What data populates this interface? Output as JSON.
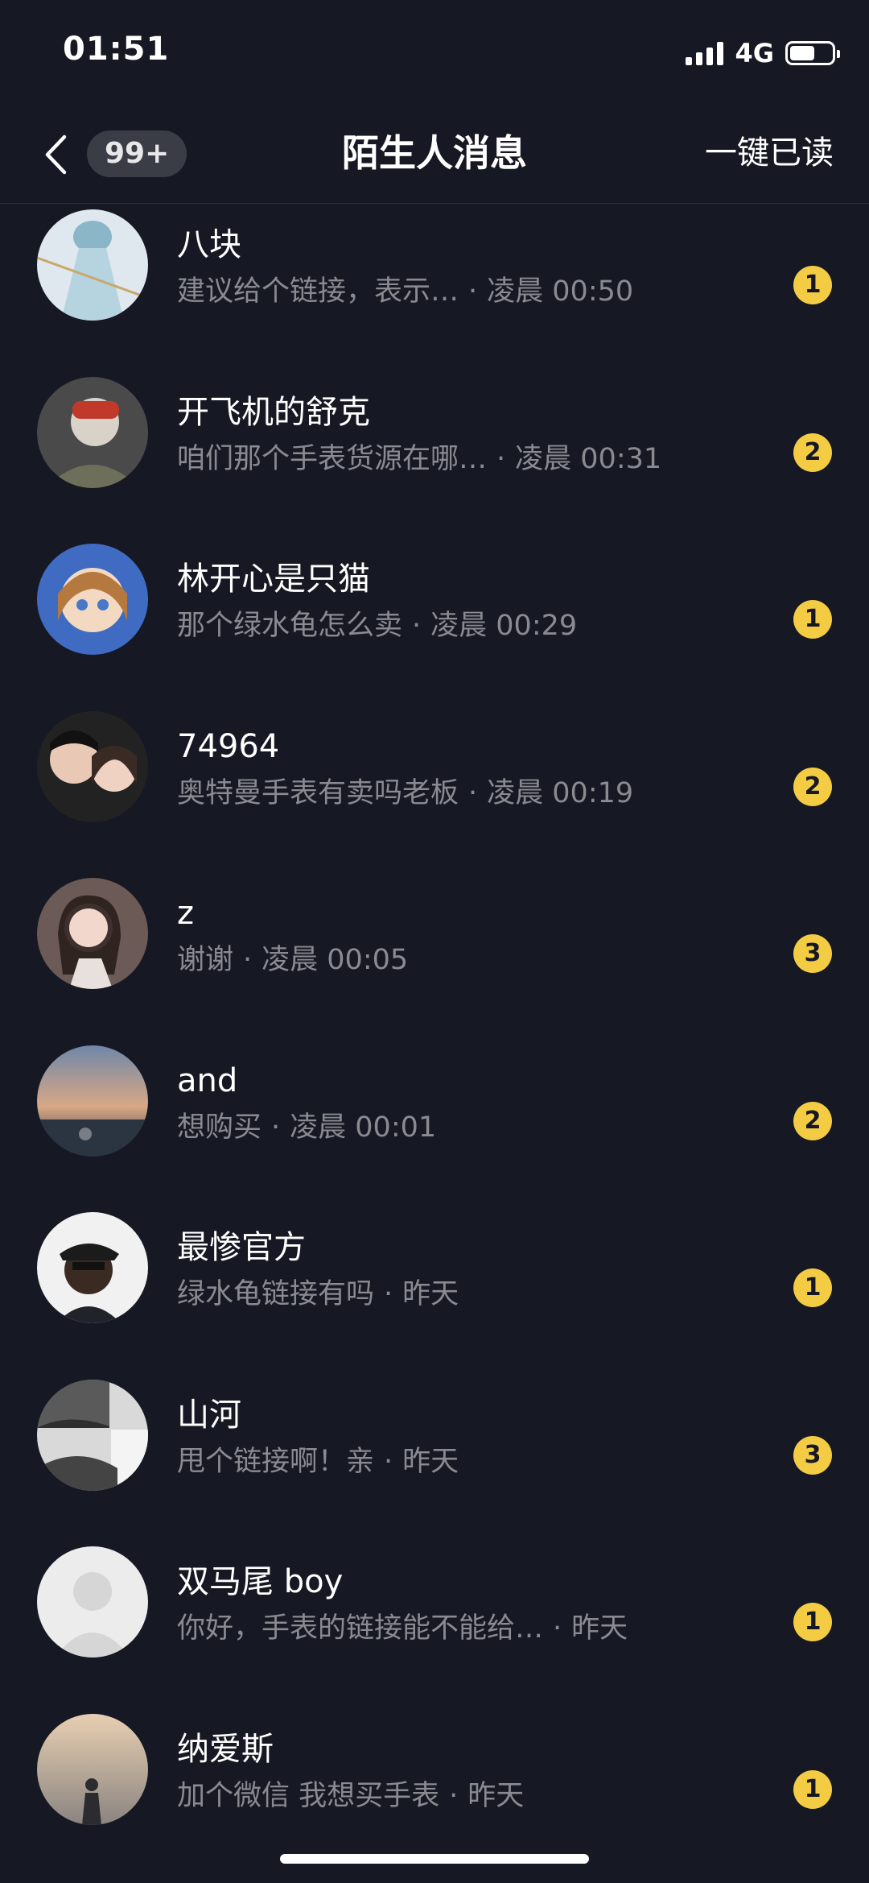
{
  "status_bar": {
    "time": "01:51",
    "network": "4G",
    "battery_level": 0.6
  },
  "header": {
    "back_icon": "chevron-left-icon",
    "unread_count": "99+",
    "title": "陌生人消息",
    "read_all_label": "一键已读"
  },
  "messages": [
    {
      "name": "八块",
      "preview": "建议给个链接，表示…",
      "time": "凌晨 00:50",
      "count": "1"
    },
    {
      "name": "开飞机的舒克",
      "preview": "咱们那个手表货源在哪…",
      "time": "凌晨 00:31",
      "count": "2"
    },
    {
      "name": "林开心是只猫",
      "preview": "那个绿水龟怎么卖",
      "time": "凌晨 00:29",
      "count": "1"
    },
    {
      "name": "74964",
      "preview": "奥特曼手表有卖吗老板",
      "time": "凌晨 00:19",
      "count": "2"
    },
    {
      "name": "z",
      "preview": "谢谢",
      "time": "凌晨 00:05",
      "count": "3"
    },
    {
      "name": "and",
      "preview": "想购买",
      "time": "凌晨 00:01",
      "count": "2"
    },
    {
      "name": "最惨官方",
      "preview": "绿水龟链接有吗",
      "time": "昨天",
      "count": "1"
    },
    {
      "name": "山河",
      "preview": "甩个链接啊！亲",
      "time": "昨天",
      "count": "3"
    },
    {
      "name": "双马尾 boy",
      "preview": "你好，手表的链接能不能给…",
      "time": "昨天",
      "count": "1"
    },
    {
      "name": "纳爱斯",
      "preview": "加个微信  我想买手表",
      "time": "昨天",
      "count": "1"
    }
  ],
  "separator": "·",
  "colors": {
    "background": "#161823",
    "badge": "#f4cc44",
    "secondary_text": "#8a8b91"
  }
}
